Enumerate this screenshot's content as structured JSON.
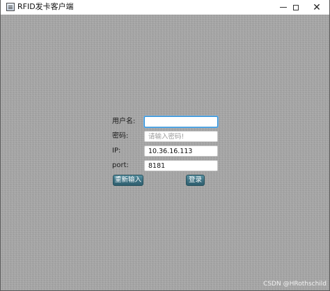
{
  "window": {
    "title": "RFID发卡客户端",
    "icon": "app-window-icon",
    "controls": {
      "minimize": "minimize-icon",
      "maximize": "maximize-icon",
      "close_glyph": "✕"
    }
  },
  "form": {
    "username_label": "用户名:",
    "username_value": "",
    "password_label": "密码:",
    "password_placeholder": "请输入密码!",
    "ip_label": "IP:",
    "ip_value": "10.36.16.113",
    "port_label": "port:",
    "port_value": "8181"
  },
  "buttons": {
    "reset_label": "重新输入",
    "login_label": "登录"
  },
  "watermark": "CSDN @HRothschild",
  "colors": {
    "background_texture": "#a9a9a9",
    "button_teal": "#3f7283",
    "focus_border": "#2f8fd6"
  }
}
